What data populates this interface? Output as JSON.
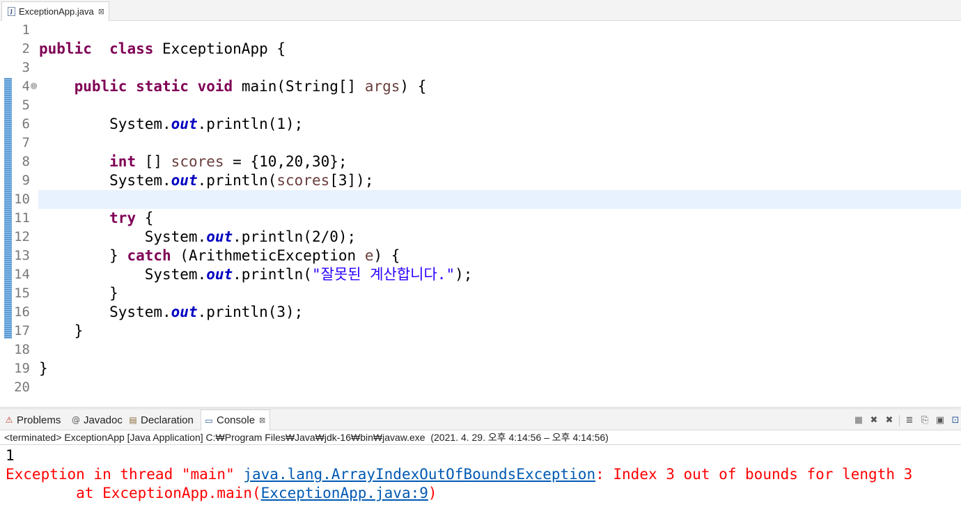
{
  "editor": {
    "tab_label": "ExceptionApp.java",
    "tab_close": "⊠",
    "lines": [
      {
        "n": "1",
        "segs": []
      },
      {
        "n": "2",
        "segs": [
          [
            "kw",
            "public"
          ],
          [
            "",
            "  "
          ],
          [
            "kw",
            "class"
          ],
          [
            "",
            " ExceptionApp {"
          ]
        ]
      },
      {
        "n": "3",
        "segs": []
      },
      {
        "n": "4",
        "segs": [
          [
            "",
            "    "
          ],
          [
            "kw",
            "public"
          ],
          [
            "",
            " "
          ],
          [
            "kw",
            "static"
          ],
          [
            "",
            " "
          ],
          [
            "kw",
            "void"
          ],
          [
            "",
            " main(String[] "
          ],
          [
            "var",
            "args"
          ],
          [
            "",
            ") {"
          ]
        ]
      },
      {
        "n": "5",
        "segs": []
      },
      {
        "n": "6",
        "segs": [
          [
            "",
            "        System."
          ],
          [
            "fld",
            "out"
          ],
          [
            "",
            ".println(1);"
          ]
        ]
      },
      {
        "n": "7",
        "segs": []
      },
      {
        "n": "8",
        "segs": [
          [
            "",
            "        "
          ],
          [
            "kw",
            "int"
          ],
          [
            "",
            " [] "
          ],
          [
            "var",
            "scores"
          ],
          [
            "",
            " = {10,20,30};"
          ]
        ]
      },
      {
        "n": "9",
        "segs": [
          [
            "",
            "        System."
          ],
          [
            "fld",
            "out"
          ],
          [
            "",
            ".println("
          ],
          [
            "var",
            "scores"
          ],
          [
            "",
            "[3]);"
          ]
        ]
      },
      {
        "n": "10",
        "segs": []
      },
      {
        "n": "11",
        "segs": [
          [
            "",
            "        "
          ],
          [
            "kw",
            "try"
          ],
          [
            "",
            " {"
          ]
        ]
      },
      {
        "n": "12",
        "segs": [
          [
            "",
            "            System."
          ],
          [
            "fld",
            "out"
          ],
          [
            "",
            ".println(2/0);"
          ]
        ]
      },
      {
        "n": "13",
        "segs": [
          [
            "",
            "        } "
          ],
          [
            "kw",
            "catch"
          ],
          [
            "",
            " (ArithmeticException "
          ],
          [
            "var",
            "e"
          ],
          [
            "",
            ") {"
          ]
        ]
      },
      {
        "n": "14",
        "segs": [
          [
            "",
            "            System."
          ],
          [
            "fld",
            "out"
          ],
          [
            "",
            ".println("
          ],
          [
            "str",
            "\"잘못된 계산합니다.\""
          ],
          [
            "",
            ");"
          ]
        ]
      },
      {
        "n": "15",
        "segs": [
          [
            "",
            "        }"
          ]
        ]
      },
      {
        "n": "16",
        "segs": [
          [
            "",
            "        System."
          ],
          [
            "fld",
            "out"
          ],
          [
            "",
            ".println(3);"
          ]
        ]
      },
      {
        "n": "17",
        "segs": [
          [
            "",
            "    }"
          ]
        ]
      },
      {
        "n": "18",
        "segs": []
      },
      {
        "n": "19",
        "segs": [
          [
            "",
            "}"
          ]
        ]
      },
      {
        "n": "20",
        "segs": []
      }
    ],
    "fold_marker": "⊖",
    "scroll_left": "‹"
  },
  "panel": {
    "tabs": [
      {
        "name": "tab-problems",
        "icon": "problems-icon",
        "glyph": "⚠",
        "label": "Problems",
        "active": false
      },
      {
        "name": "tab-javadoc",
        "icon": "javadoc-icon",
        "glyph": "@",
        "label": "Javadoc",
        "active": false
      },
      {
        "name": "tab-declaration",
        "icon": "declaration-icon",
        "glyph": "▤",
        "label": "Declaration",
        "active": false
      },
      {
        "name": "tab-console",
        "icon": "console-icon",
        "glyph": "▭",
        "label": "Console",
        "active": true
      }
    ],
    "console_close": "⊠",
    "toolbar_glyphs": {
      "terminate": "■",
      "remove": "✖",
      "remove_all": "✖",
      "scroll_lock": "≣",
      "pin": "⎘",
      "display": "▣",
      "open": "⊡"
    },
    "description": "<terminated> ExceptionApp [Java Application] C:₩Program Files₩Java₩jdk-16₩bin₩javaw.exe  (2021. 4. 29. 오후 4:14:56 – 오후 4:14:56)"
  },
  "console": {
    "line1": "1",
    "err_prefix": "Exception in thread \"main\" ",
    "err_link": "java.lang.ArrayIndexOutOfBoundsException",
    "err_suffix": ": Index 3 out of bounds for length 3",
    "at_prefix": "        at ExceptionApp.main(",
    "at_link": "ExceptionApp.java:9",
    "at_suffix": ")"
  },
  "colors": {
    "keyword": "#7f0055",
    "field": "#0000c0",
    "local_var": "#6a3e3e",
    "string": "#2a00ff",
    "error": "#ff0000",
    "link": "#0059b3"
  }
}
